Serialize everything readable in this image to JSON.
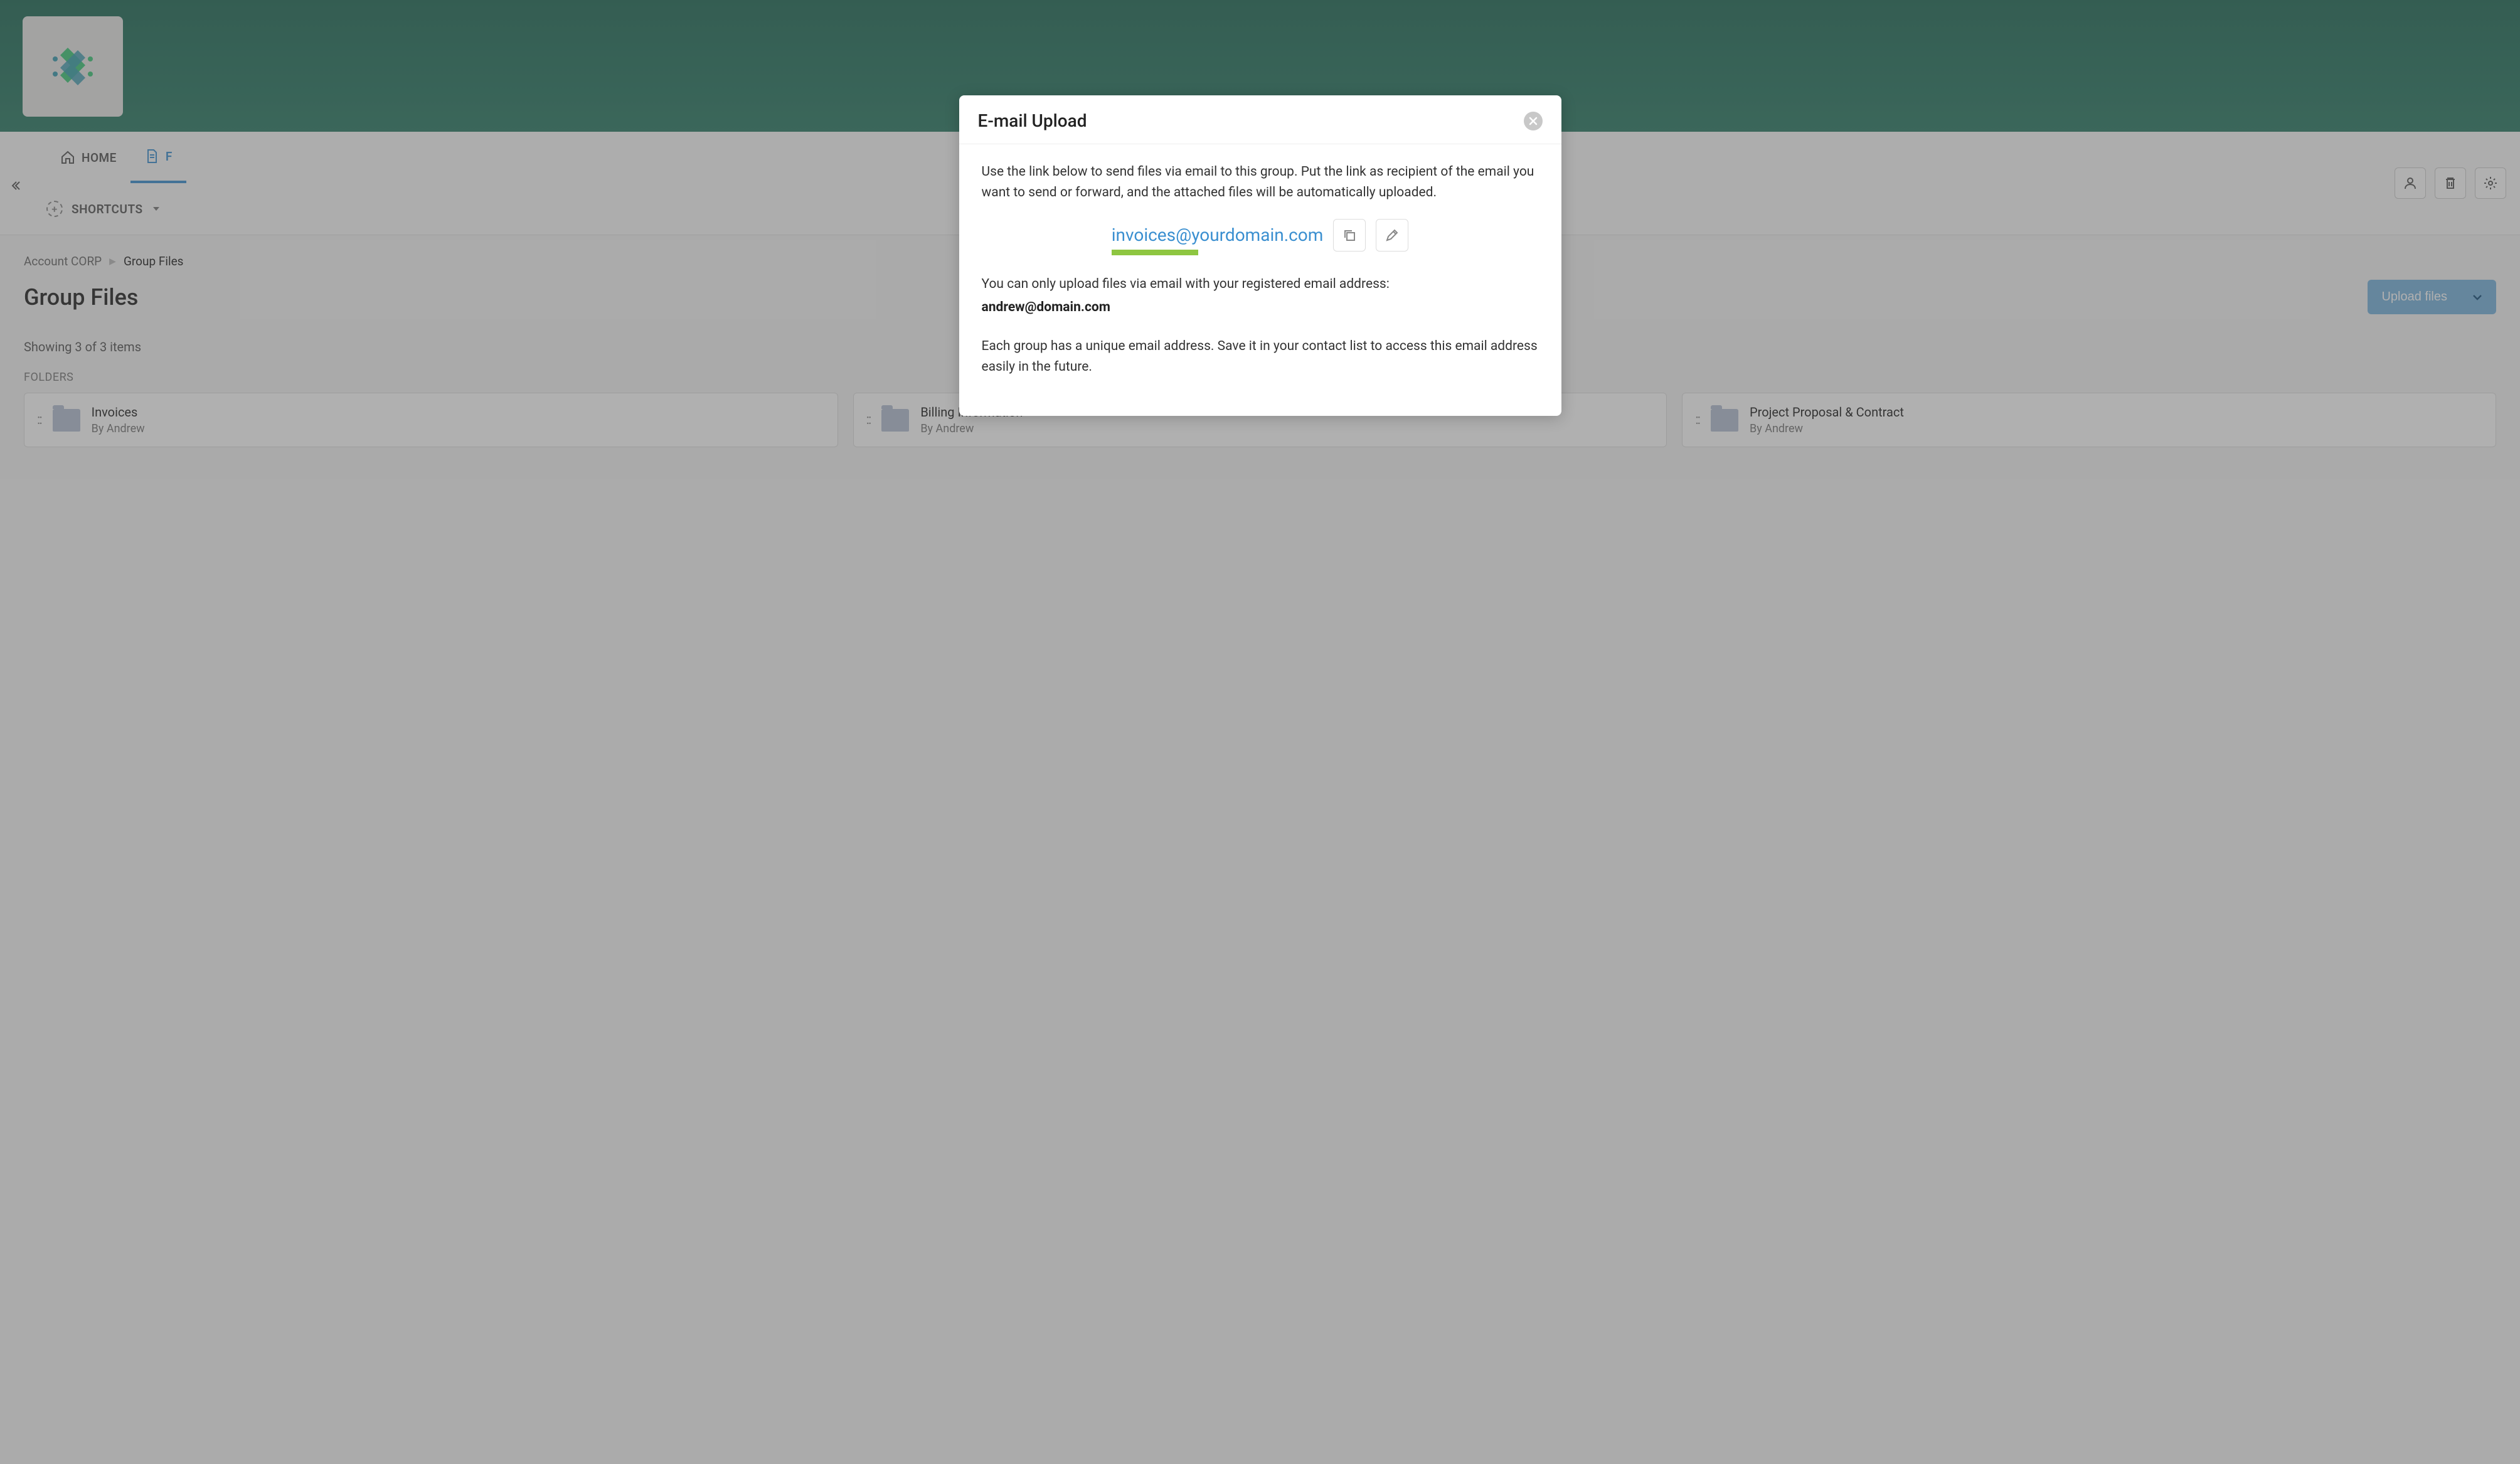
{
  "nav": {
    "home_label": "HOME",
    "files_label_initial": "F",
    "shortcuts_label": "SHORTCUTS"
  },
  "breadcrumb": {
    "parent": "Account CORP",
    "current": "Group Files"
  },
  "page": {
    "title": "Group Files",
    "upload_button": "Upload files",
    "showing": "Showing 3 of 3 items",
    "folders_label": "FOLDERS"
  },
  "folders": [
    {
      "name": "Invoices",
      "by": "By Andrew"
    },
    {
      "name": "Billing Information",
      "by": "By Andrew"
    },
    {
      "name": "Project Proposal & Contract",
      "by": "By Andrew"
    }
  ],
  "modal": {
    "title": "E-mail Upload",
    "intro": "Use the link below to send files via email to this group. Put the link as recipient of the email you want to send or forward, and the attached files will be automatically uploaded.",
    "email": "invoices@yourdomain.com",
    "registered_intro": "You can only upload files via email with your registered email address:",
    "registered_email": "andrew@domain.com",
    "unique_note": "Each group has a unique email address. Save it in your contact list to access this email address easily in the future."
  }
}
